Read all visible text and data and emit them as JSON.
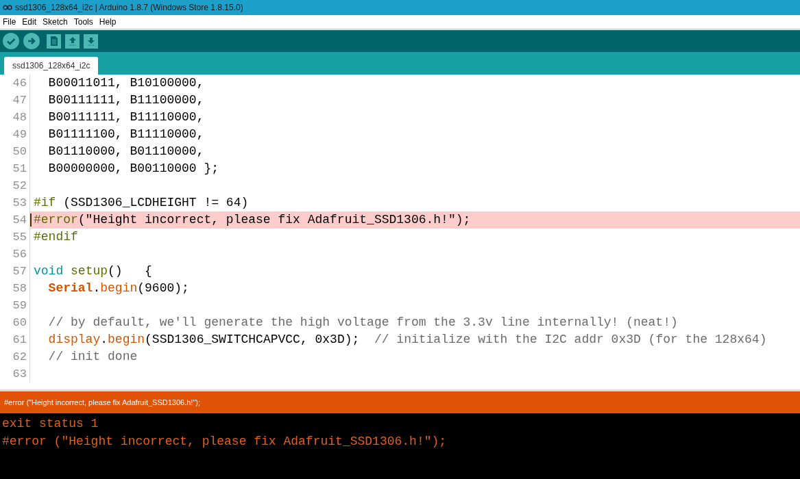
{
  "window": {
    "title": "ssd1306_128x64_i2c | Arduino 1.8.7 (Windows Store 1.8.15.0)"
  },
  "menu": [
    "File",
    "Edit",
    "Sketch",
    "Tools",
    "Help"
  ],
  "toolbar": [
    {
      "kind": "verify"
    },
    {
      "kind": "upload"
    },
    {
      "kind": "new"
    },
    {
      "kind": "open"
    },
    {
      "kind": "save"
    }
  ],
  "tabs": [
    {
      "label": "ssd1306_128x64_i2c",
      "selected": true
    }
  ],
  "editor": {
    "lines": [
      {
        "number": "46",
        "highlighted": false,
        "caret": false,
        "tokens": [
          {
            "kind": "plain",
            "text": "  B00011011, B10100000,"
          }
        ]
      },
      {
        "number": "47",
        "highlighted": false,
        "caret": false,
        "tokens": [
          {
            "kind": "plain",
            "text": "  B00111111, B11100000,"
          }
        ]
      },
      {
        "number": "48",
        "highlighted": false,
        "caret": false,
        "tokens": [
          {
            "kind": "plain",
            "text": "  B00111111, B11110000,"
          }
        ]
      },
      {
        "number": "49",
        "highlighted": false,
        "caret": false,
        "tokens": [
          {
            "kind": "plain",
            "text": "  B01111100, B11110000,"
          }
        ]
      },
      {
        "number": "50",
        "highlighted": false,
        "caret": false,
        "tokens": [
          {
            "kind": "plain",
            "text": "  B01110000, B01110000,"
          }
        ]
      },
      {
        "number": "51",
        "highlighted": false,
        "caret": false,
        "tokens": [
          {
            "kind": "plain",
            "text": "  B00000000, B00110000 };"
          }
        ]
      },
      {
        "number": "52",
        "highlighted": false,
        "caret": false
      },
      {
        "number": "53",
        "highlighted": false,
        "caret": false,
        "tokens": [
          {
            "kind": "directive",
            "text": "#if"
          },
          {
            "kind": "plain",
            "text": " (SSD1306_LCDHEIGHT != 64)"
          }
        ]
      },
      {
        "number": "54",
        "highlighted": true,
        "caret": true,
        "tokens": [
          {
            "kind": "directive",
            "text": "#error"
          },
          {
            "kind": "plain",
            "text": "(\"Height incorrect, please fix Adafruit_SSD1306.h!\");"
          }
        ]
      },
      {
        "number": "55",
        "highlighted": false,
        "caret": false,
        "tokens": [
          {
            "kind": "directive",
            "text": "#endif"
          }
        ]
      },
      {
        "number": "56",
        "highlighted": false,
        "caret": false
      },
      {
        "number": "57",
        "highlighted": false,
        "caret": false,
        "tokens": [
          {
            "kind": "type",
            "text": "void"
          },
          {
            "kind": "directive",
            "text": " setup"
          },
          {
            "kind": "plain",
            "text": "()   {"
          }
        ]
      },
      {
        "number": "58",
        "highlighted": false,
        "caret": false,
        "tokens": [
          {
            "kind": "class",
            "text": "  Serial"
          },
          {
            "kind": "plain",
            "text": "."
          },
          {
            "kind": "function",
            "text": "begin"
          },
          {
            "kind": "plain",
            "text": "(9600);"
          }
        ]
      },
      {
        "number": "59",
        "highlighted": false,
        "caret": false
      },
      {
        "number": "60",
        "highlighted": false,
        "caret": false,
        "tokens": [
          {
            "kind": "comment",
            "text": "  // by default, we'll generate the high voltage from the 3.3v line internally! (neat!)"
          }
        ]
      },
      {
        "number": "61",
        "highlighted": false,
        "caret": false,
        "tokens": [
          {
            "kind": "function",
            "text": "  display"
          },
          {
            "kind": "plain",
            "text": "."
          },
          {
            "kind": "function",
            "text": "begin"
          },
          {
            "kind": "plain",
            "text": "(SSD1306_SWITCHCAPVCC, 0x3D);"
          },
          {
            "kind": "comment",
            "text": "  // initialize with the I2C addr 0x3D (for the 128x64)"
          }
        ]
      },
      {
        "number": "62",
        "highlighted": false,
        "caret": false,
        "tokens": [
          {
            "kind": "comment",
            "text": "  // init done"
          }
        ]
      },
      {
        "number": "63",
        "highlighted": false,
        "caret": false
      }
    ]
  },
  "status_bar": {
    "text": "#error (\"Height incorrect, please fix Adafruit_SSD1306.h!\");"
  },
  "console": {
    "lines": [
      "exit status 1",
      "#error (\"Height incorrect, please fix Adafruit_SSD1306.h!\");"
    ]
  }
}
